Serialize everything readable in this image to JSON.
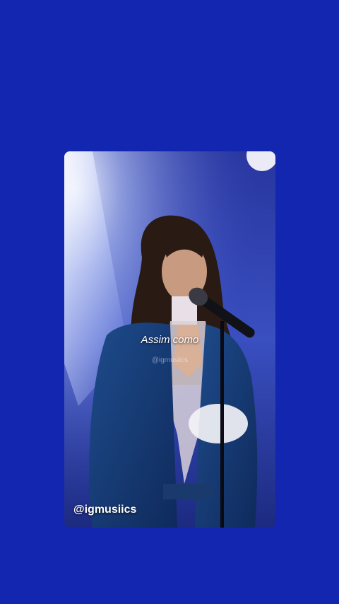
{
  "background_color": "#1226b0",
  "video": {
    "caption": "Assim como",
    "watermark": "@igmusiics",
    "handle": "@igmusiics"
  }
}
